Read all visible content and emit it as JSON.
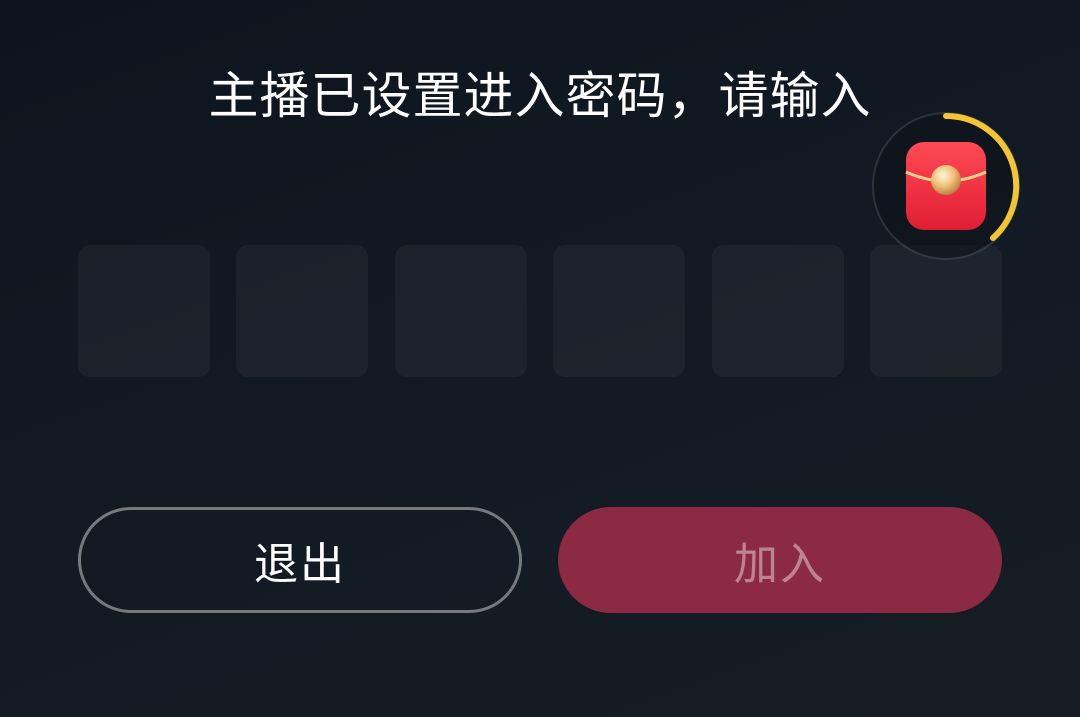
{
  "dialog": {
    "title": "主播已设置进入密码，请输入"
  },
  "password": {
    "digits": [
      "",
      "",
      "",
      "",
      "",
      ""
    ]
  },
  "actions": {
    "exit_label": "退出",
    "join_label": "加入"
  },
  "floating_widget": {
    "icon": "red-packet-icon",
    "progress_percent": 40,
    "ring_color": "#f5c531",
    "packet_color": "#ef3340"
  },
  "colors": {
    "join_button": "#8c2a43",
    "pin_box": "#1a2129"
  }
}
